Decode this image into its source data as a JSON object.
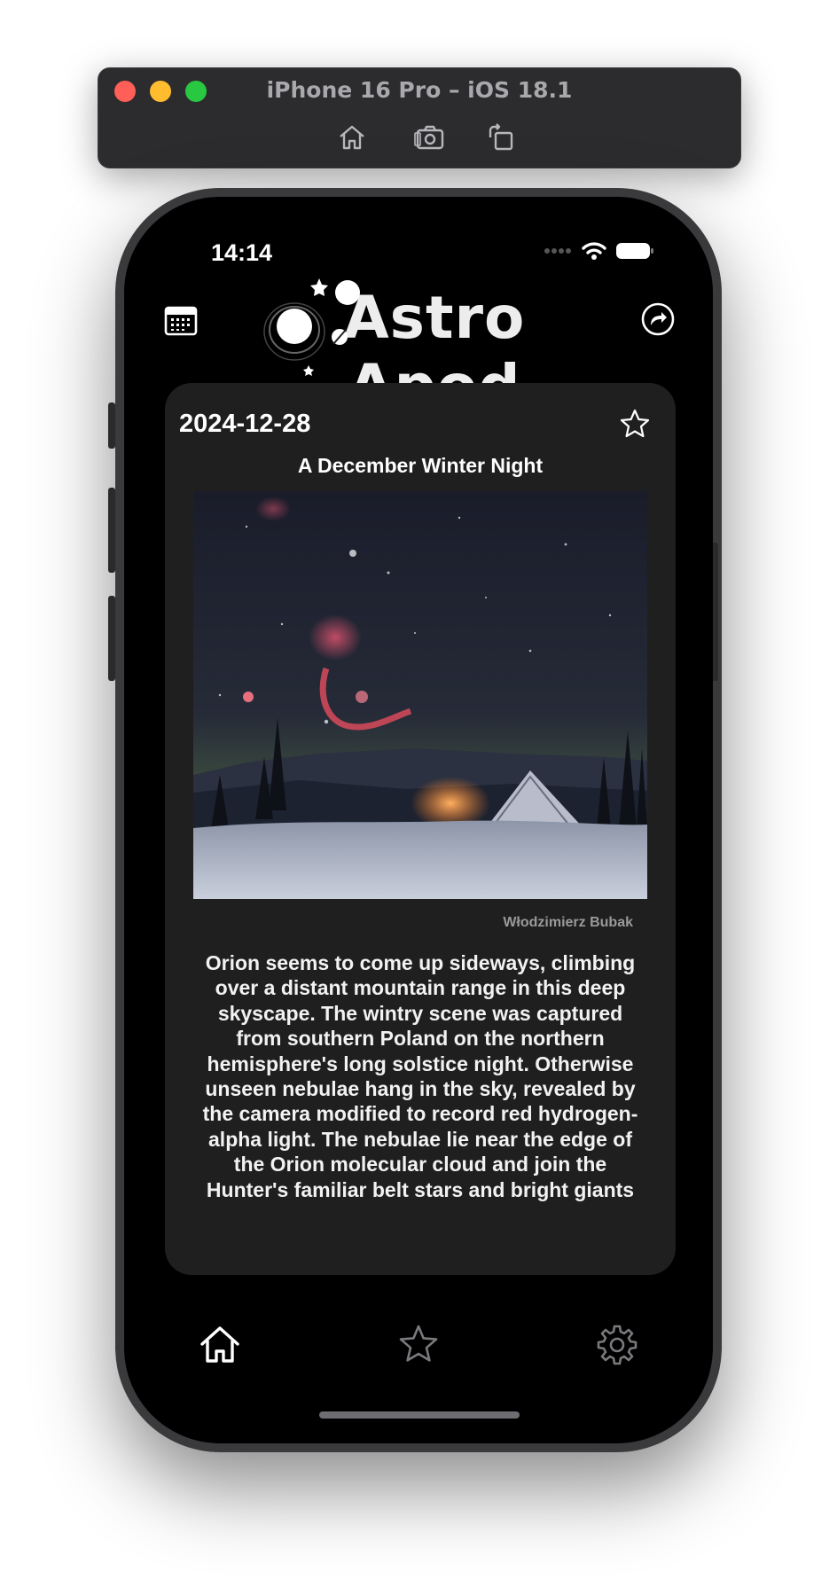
{
  "simulator": {
    "title": "iPhone 16 Pro – iOS 18.1",
    "tools": [
      "home-icon",
      "screenshot-icon",
      "rotate-icon"
    ]
  },
  "status_bar": {
    "time": "14:14"
  },
  "header": {
    "app_name": "Astro Apod",
    "left_icon": "calendar-icon",
    "right_icon": "share-icon"
  },
  "apod": {
    "date": "2024-12-28",
    "title": "A December Winter Night",
    "copyright": "Włodzimierz Bubak",
    "explanation": "Orion seems to come up sideways, climbing over a distant mountain range in this deep skyscape. The wintry scene was captured from southern Poland on the northern hemisphere's long solstice night. Otherwise unseen nebulae hang in the sky, revealed by the camera modified to record red hydrogen-alpha light. The nebulae lie near the edge of the Orion molecular cloud and join the Hunter's familiar belt stars and bright giants"
  },
  "tab_bar": {
    "items": [
      {
        "icon": "home-icon",
        "selected": true
      },
      {
        "icon": "star-icon",
        "selected": false
      },
      {
        "icon": "gear-icon",
        "selected": false
      }
    ]
  },
  "colors": {
    "background": "#000000",
    "card": "#1f1f1f",
    "text": "#ffffff",
    "muted": "#9a9a9a"
  }
}
